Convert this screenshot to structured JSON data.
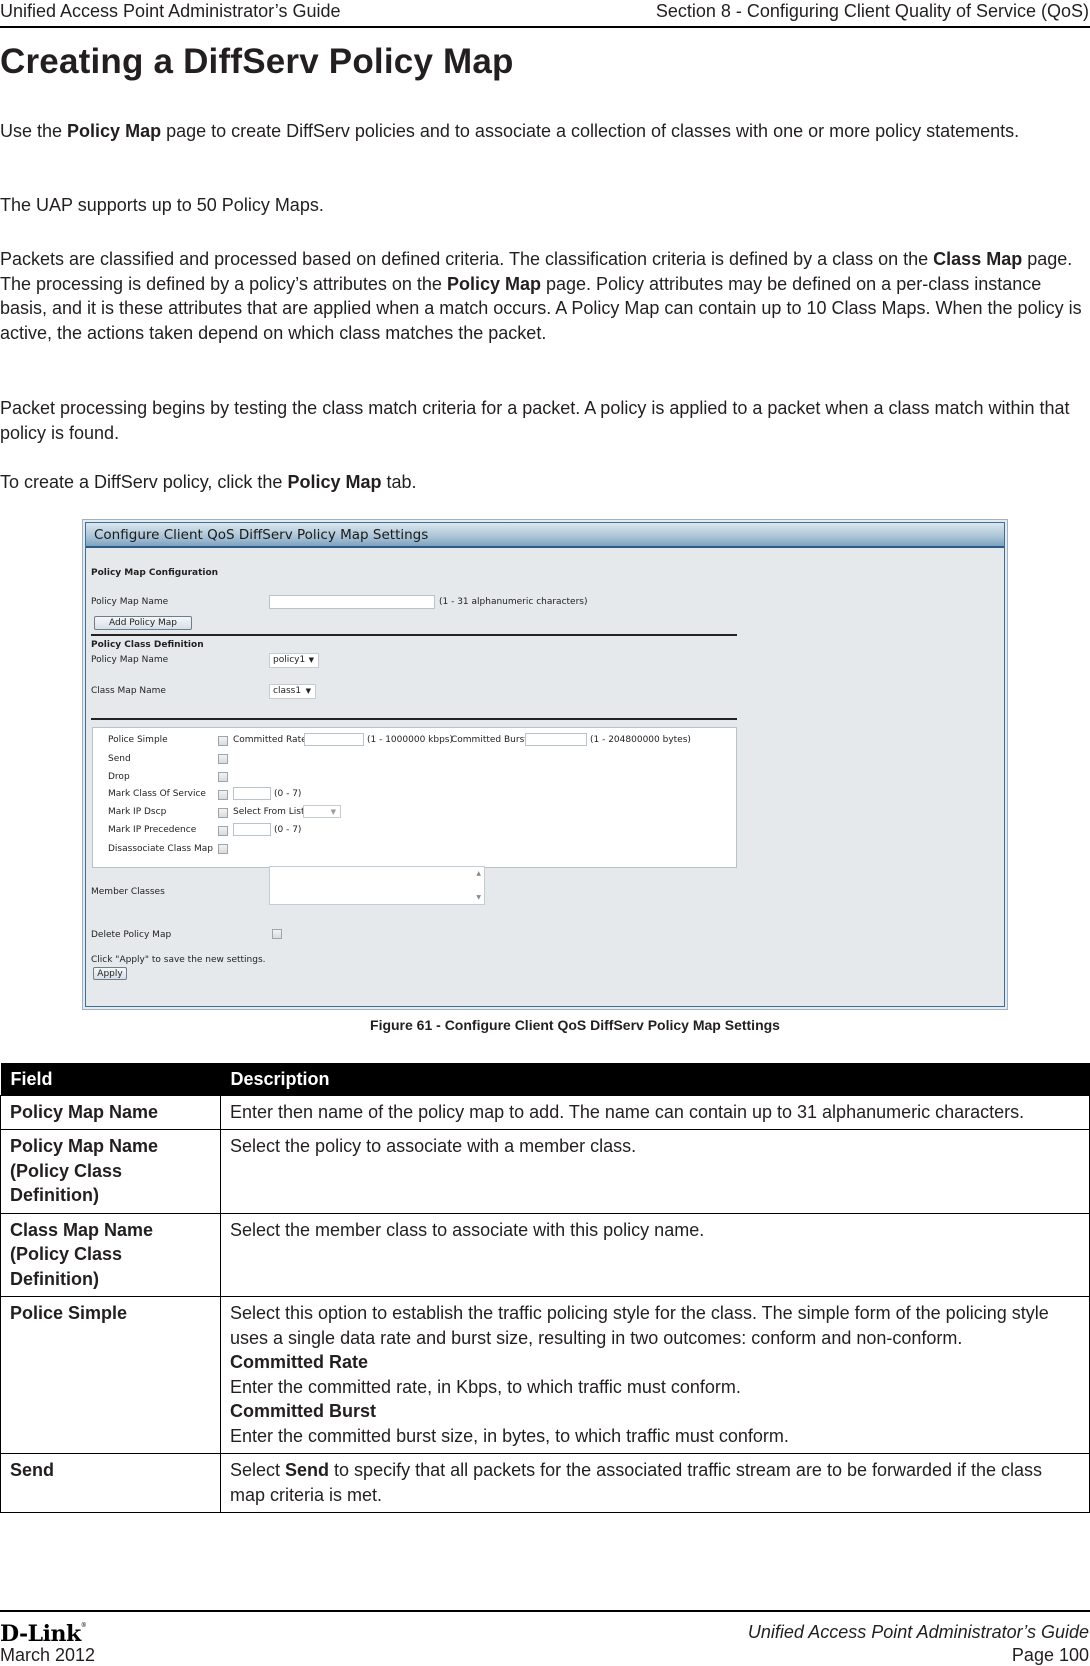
{
  "header": {
    "left": "Unified Access Point Administrator’s Guide",
    "right": "Section 8 - Configuring Client Quality of Service (QoS)"
  },
  "title": "Creating a DiffServ Policy Map",
  "paragraphs": {
    "p1": {
      "a": "Use the ",
      "b": "Policy Map",
      "c": " page to create DiffServ policies and to associate a collection of classes with one or more policy statements."
    },
    "p2": "The UAP supports up to 50 Policy Maps.",
    "p3": {
      "a": "Packets are classified and processed based on defined criteria. The classification criteria is defined by a class on the ",
      "b": "Class Map",
      "c": " page. The processing is defined by a policy’s attributes on the ",
      "d": "Policy Map",
      "e": " page. Policy attributes may be defined on a per-class instance basis, and it is these attributes that are applied when a match occurs. A Policy Map can contain up to 10 Class Maps. When the policy is active, the actions taken depend on which class matches the packet."
    },
    "p4": "Packet processing begins by testing the class match criteria for a packet. A policy is applied to a packet when a class match within that policy is found.",
    "p5": {
      "a": "To create a DiffServ policy, click the ",
      "b": "Policy Map",
      "c": " tab."
    }
  },
  "screenshot": {
    "title": "Configure Client QoS DiffServ Policy Map Settings",
    "config_section": "Policy Map Configuration",
    "policy_map_name_label": "Policy Map Name",
    "policy_map_name_value": "",
    "policy_map_name_hint": "(1 - 31 alphanumeric characters)",
    "add_button": "Add Policy Map",
    "class_def_section": "Policy Class Definition",
    "pcd_policy_label": "Policy Map Name",
    "pcd_policy_value": "policy1",
    "pcd_class_label": "Class Map Name",
    "pcd_class_value": "class1",
    "actions": {
      "police_simple": "Police Simple",
      "committed_rate_label": "Committed Rate",
      "committed_rate_value": "",
      "committed_rate_hint": "(1 - 1000000 kbps)",
      "committed_burst_label": "Committed Burst",
      "committed_burst_value": "",
      "committed_burst_hint": "(1 - 204800000 bytes)",
      "send": "Send",
      "drop": "Drop",
      "mark_cos": "Mark Class Of Service",
      "mark_cos_value": "",
      "mark_cos_hint": "(0 - 7)",
      "mark_dscp": "Mark IP Dscp",
      "mark_dscp_select_label": "Select From List",
      "mark_dscp_value": "",
      "mark_prec": "Mark IP Precedence",
      "mark_prec_value": "",
      "mark_prec_hint": "(0 - 7)",
      "disassociate": "Disassociate Class Map"
    },
    "member_classes_label": "Member Classes",
    "delete_label": "Delete Policy Map",
    "apply_hint": "Click \"Apply\" to save the new settings.",
    "apply_button": "Apply"
  },
  "caption": "Figure 61 - Configure Client QoS DiffServ Policy Map Settings",
  "table": {
    "headers": [
      "Field",
      "Description"
    ],
    "rows": [
      {
        "field": "Policy Map Name",
        "desc": "Enter then name of the policy map to add. The name can contain up to 31 alphanumeric characters."
      },
      {
        "field": "Policy Map Name (Policy Class Definition)",
        "desc": "Select the policy to associate with a member class."
      },
      {
        "field": "Class Map Name (Policy Class Definition)",
        "desc": "Select the member class to associate with this policy name."
      },
      {
        "field": "Police Simple",
        "desc": "Select this option to establish the traffic policing style for the class. The simple form of the policing style uses a single data rate and burst size, resulting in two outcomes: conform and non-conform.",
        "sub1_title": "Committed Rate",
        "sub1_text": "Enter the committed rate, in Kbps, to which traffic must conform.",
        "sub2_title": "Committed Burst",
        "sub2_text": "Enter the committed burst size, in bytes, to which traffic must conform."
      },
      {
        "field": "Send",
        "desc_a": "Select ",
        "desc_b": "Send",
        "desc_c": " to specify that all packets for the associated traffic stream are to be forwarded if the class map criteria is met."
      }
    ]
  },
  "footer": {
    "logo": "D-Link",
    "date": "March 2012",
    "guide": "Unified Access Point Administrator’s Guide",
    "page": "Page 100"
  }
}
